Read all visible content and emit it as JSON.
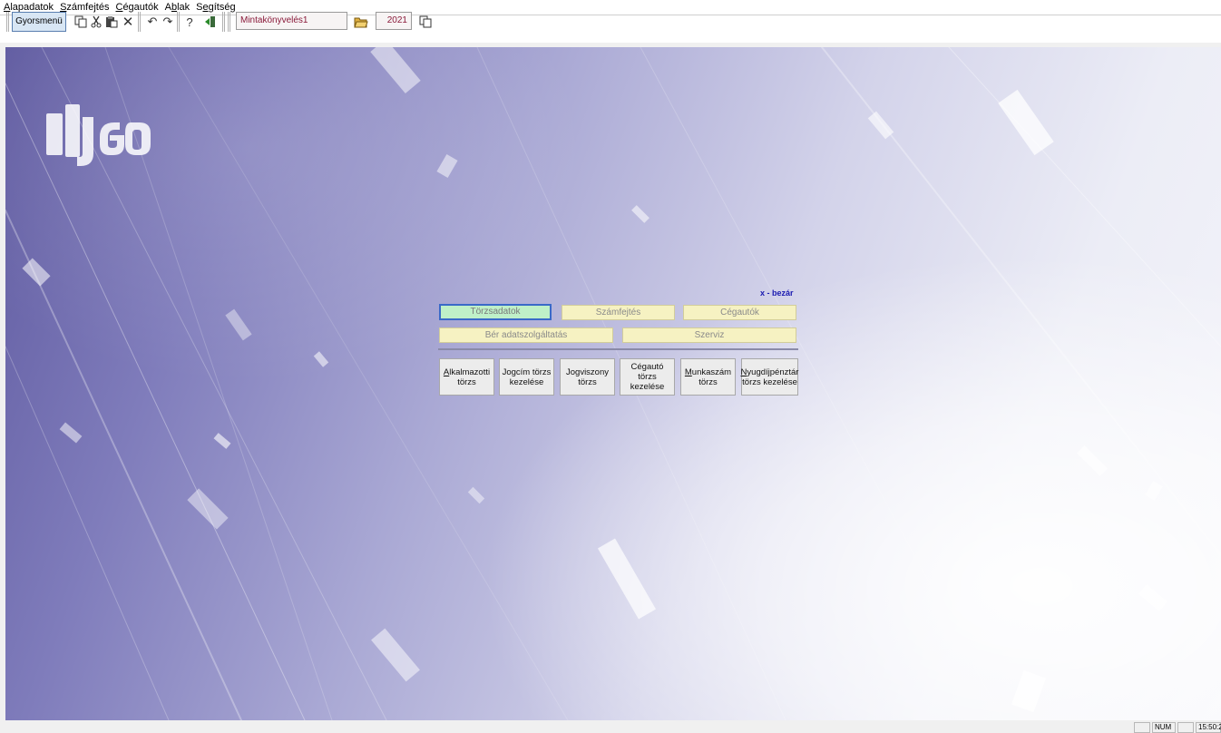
{
  "menubar": {
    "items": [
      {
        "accel": "A",
        "rest": "lapadatok"
      },
      {
        "accel": "S",
        "rest": "zámfejtés"
      },
      {
        "accel": "C",
        "rest": "égautók"
      },
      {
        "pre": "A",
        "accel": "b",
        "rest": "lak"
      },
      {
        "pre": "S",
        "accel": "e",
        "rest": "gítség"
      }
    ]
  },
  "toolbar": {
    "quickmenu_label": "Gyorsmenü",
    "company": "Mintakönyvelés1",
    "year": "2021",
    "icons": [
      "copy-icon",
      "cut-icon",
      "paste-icon",
      "delete-icon",
      "undo-icon",
      "redo-icon",
      "help-icon",
      "exit-icon",
      "open-folder-icon",
      "copy-year-icon"
    ]
  },
  "center_menu": {
    "close_label": "x - bezár",
    "row1": [
      "Törzsadatok",
      "Számfejtés",
      "Cégautók"
    ],
    "row2": [
      "Bér adatszolgáltatás",
      "Szerviz"
    ],
    "active_tab": "Törzsadatok",
    "sub_buttons": [
      {
        "accel": "A",
        "rest": "lkalmazotti",
        "line2": "törzs"
      },
      {
        "accel": "",
        "rest": "Jogcím törzs",
        "line2": "kezelése"
      },
      {
        "accel": "",
        "rest": "Jogviszony",
        "line2": "törzs"
      },
      {
        "accel": "",
        "rest": "Cégautó törzs",
        "line2": "kezelése"
      },
      {
        "accel": "M",
        "rest": "unkaszám",
        "line2": "törzs"
      },
      {
        "accel": "N",
        "rest": "yugdíjpénztár",
        "line2": "törzs kezelése"
      }
    ]
  },
  "statusbar": {
    "num": "NUM",
    "time": "15:50:2"
  },
  "colors": {
    "accent_blue": "#3a6ac8",
    "tab_yellow": "#f6f2c2",
    "tab_active_green": "#bff0c8",
    "close_link": "#1a1ab0",
    "company_text": "#8a1a3a"
  }
}
